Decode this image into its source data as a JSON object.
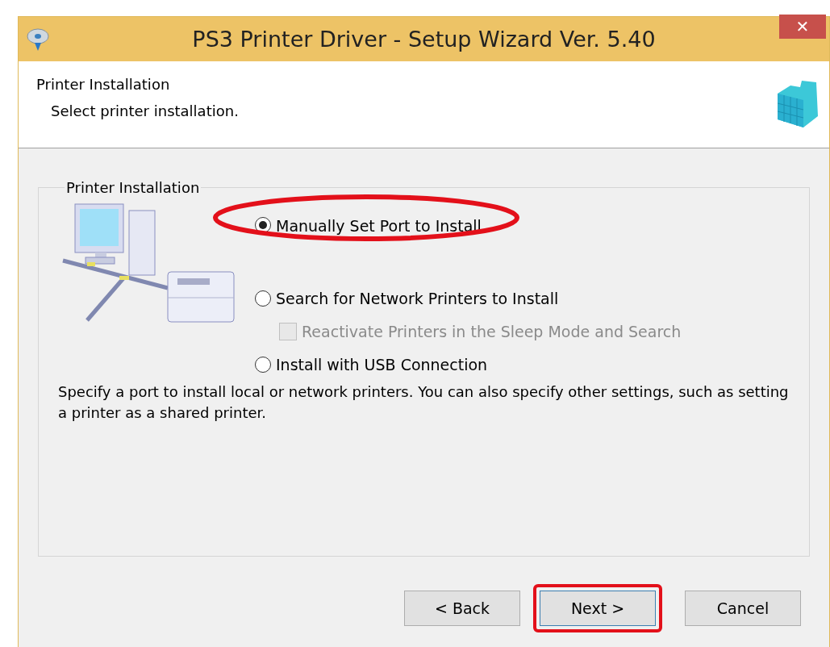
{
  "window": {
    "title": "PS3 Printer Driver - Setup Wizard Ver. 5.40",
    "close": "✕"
  },
  "header": {
    "title": "Printer Installation",
    "subtitle": "Select printer installation."
  },
  "group": {
    "label": "Printer Installation",
    "options": [
      {
        "kind": "radio",
        "label": "Manually Set Port to Install",
        "selected": true,
        "disabled": false,
        "highlighted": true
      },
      {
        "kind": "radio",
        "label": "Search for Network Printers to Install",
        "selected": false,
        "disabled": false,
        "highlighted": false
      },
      {
        "kind": "checkbox",
        "label": "Reactivate Printers in the Sleep Mode and Search",
        "checked": false,
        "disabled": true,
        "highlighted": false
      },
      {
        "kind": "radio",
        "label": "Install with USB Connection",
        "selected": false,
        "disabled": false,
        "highlighted": false
      }
    ],
    "description": "Specify a port to install local or network printers. You can also specify other settings, such as setting a printer as a shared printer."
  },
  "buttons": [
    {
      "label": "< Back",
      "highlighted": false
    },
    {
      "label": "Next >",
      "highlighted": true
    },
    {
      "label": "Cancel",
      "highlighted": false
    }
  ]
}
